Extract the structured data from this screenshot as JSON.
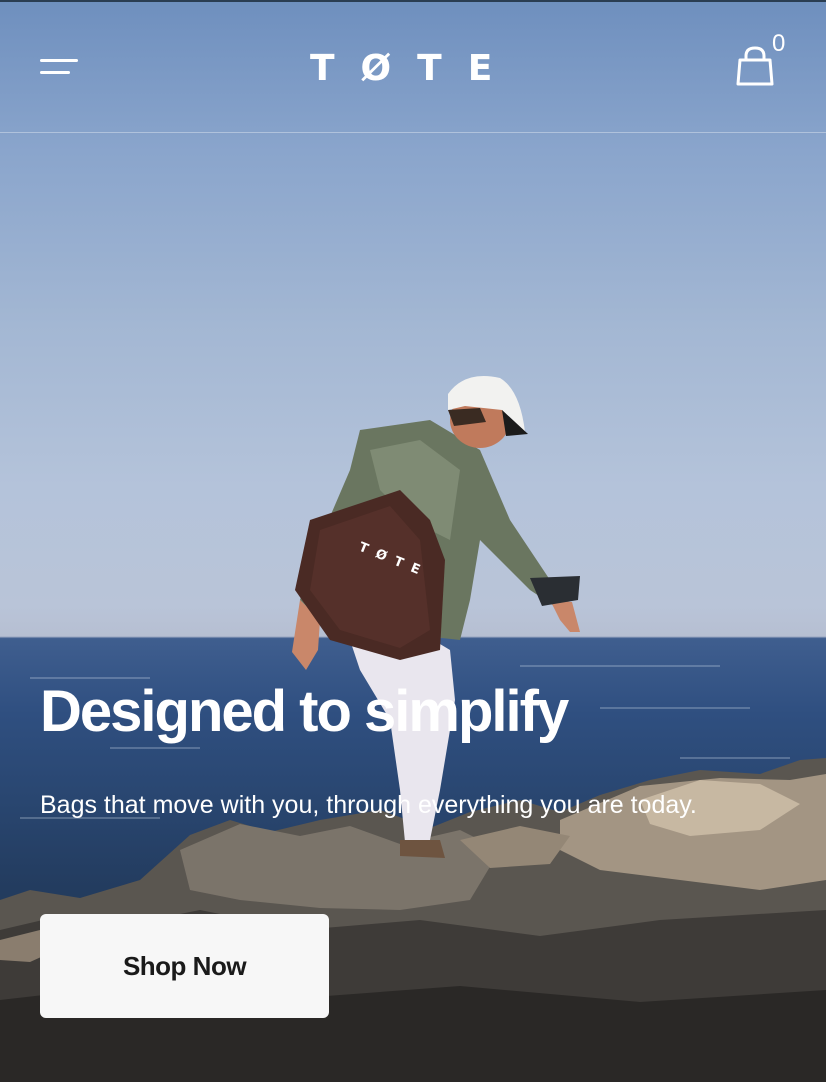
{
  "header": {
    "logo": "TØTE",
    "menu_icon": "hamburger-menu-icon",
    "cart_icon": "shopping-bag-icon",
    "cart_count": "0"
  },
  "hero": {
    "headline": "Designed to simplify",
    "subtext": "Bags that move with you, through everything you are today.",
    "cta_label": "Shop Now",
    "bag_print": "TØTE"
  },
  "colors": {
    "sky_top": "#6e8fbe",
    "sea": "#2f4f80",
    "button_bg": "#f7f7f7",
    "button_text": "#1a1a1a",
    "text": "#ffffff"
  }
}
